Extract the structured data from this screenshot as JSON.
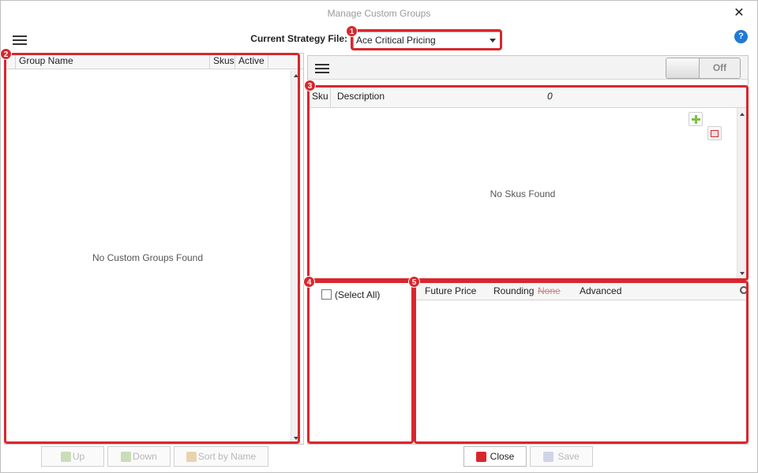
{
  "window": {
    "title": "Manage Custom Groups",
    "close_glyph": "✕"
  },
  "header": {
    "strategy_label": "Current Strategy File:",
    "strategy_value": "Ace Critical Pricing",
    "help_glyph": "?"
  },
  "badges": [
    "1",
    "2",
    "3",
    "4",
    "5"
  ],
  "left_grid": {
    "columns": [
      "Group Name",
      "Skus",
      "Active"
    ],
    "empty_message": "No Custom Groups Found"
  },
  "left_buttons": {
    "up": "Up",
    "down": "Down",
    "sort": "Sort by Name"
  },
  "right_toolbar": {
    "toggle_label": "Off"
  },
  "sku_grid": {
    "columns": [
      "Sku",
      "Description"
    ],
    "count": "0",
    "empty_message": "No Skus Found"
  },
  "filter_panel": {
    "select_all": "(Select All)"
  },
  "detail_panel": {
    "future_price": "Future Price",
    "rounding": "Rounding",
    "rounding_value": "None",
    "advanced": "Advanced"
  },
  "bottom_buttons": {
    "close": "Close",
    "save": "Save"
  },
  "colors": {
    "annotation_red": "#d9262d",
    "help_blue": "#1e7ad6",
    "add_green": "#7cc142"
  },
  "icons": [
    "hamburger-icon",
    "close-icon",
    "help-icon",
    "add-icon",
    "remove-icon",
    "up-arrow-icon",
    "down-arrow-icon",
    "sort-az-icon",
    "close-x-icon",
    "save-icon",
    "pin-icon"
  ]
}
